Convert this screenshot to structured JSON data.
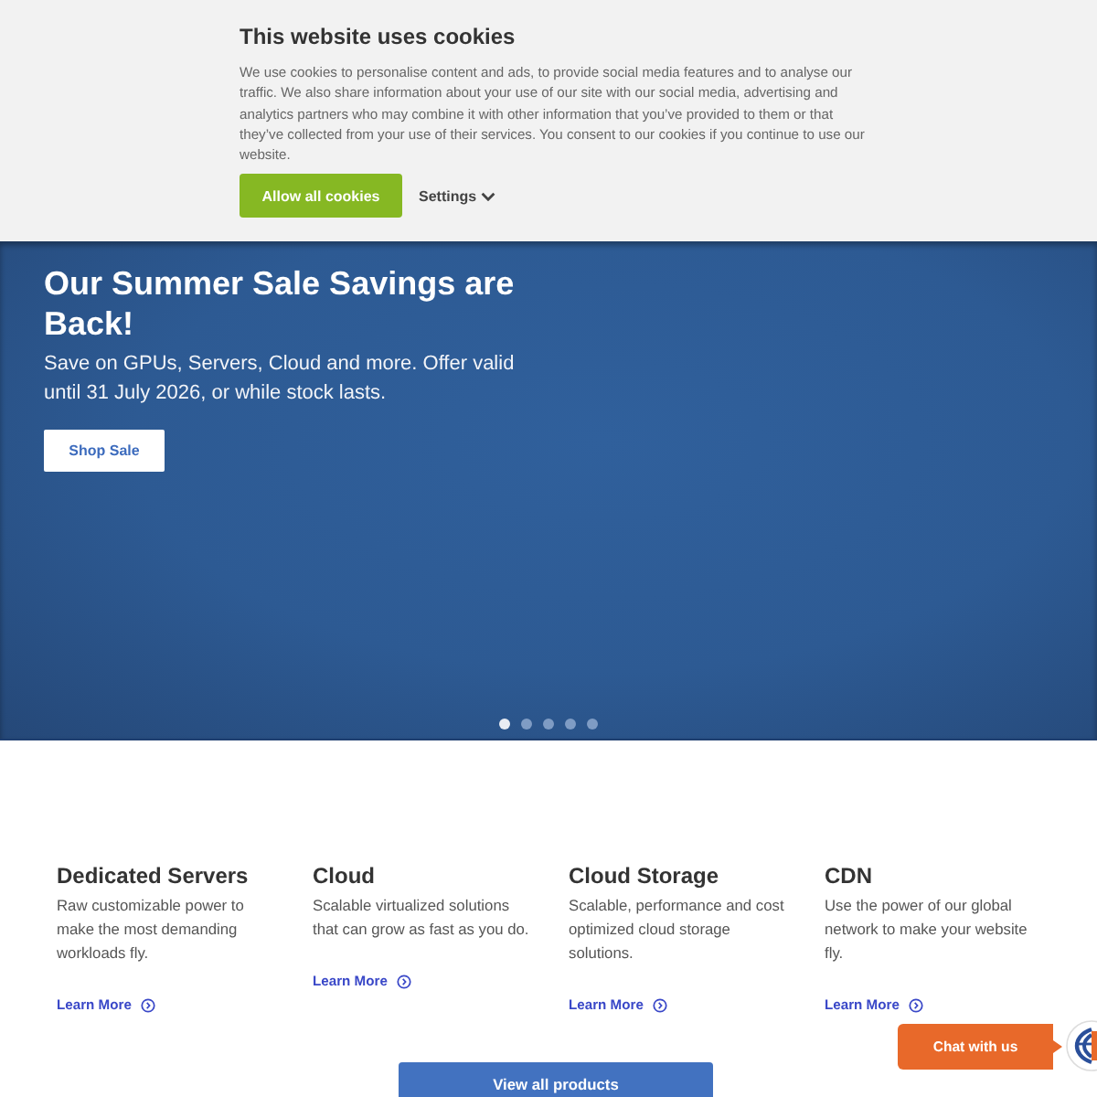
{
  "cookie_banner": {
    "title": "This website uses cookies",
    "text": "We use cookies to personalise content and ads, to provide social media features and to analyse our traffic. We also share information about your use of our site with our social media, advertising and analytics partners who may combine it with other information that you’ve provided to them or that they’ve collected from your use of their services. You consent to our cookies if you continue to use our website.",
    "allow_button": "Allow all cookies",
    "settings_button": "Settings"
  },
  "hero": {
    "title": "Our Summer Sale Savings are Back!",
    "text": "Save on GPUs, Servers, Cloud and more. Offer valid until 31 July 2026, or while stock lasts.",
    "button": "Shop Sale",
    "slides": [
      {
        "selected": true
      },
      {
        "selected": false
      },
      {
        "selected": false
      },
      {
        "selected": false
      },
      {
        "selected": false
      }
    ]
  },
  "products": [
    {
      "title": "Dedicated Servers",
      "text": "Raw customizable power to make the most demanding workloads fly.",
      "link": "Learn More"
    },
    {
      "title": "Cloud",
      "text": "Scalable virtualized solutions that can grow as fast as you do.",
      "link": "Learn More"
    },
    {
      "title": "Cloud Storage",
      "text": "Scalable, performance and cost optimized cloud storage solutions.",
      "link": "Learn More"
    },
    {
      "title": "CDN",
      "text": "Use the power of our global network to make your website fly.",
      "link": "Learn More"
    }
  ],
  "view_all_button": "View all products",
  "chat_button": "Chat with us"
}
